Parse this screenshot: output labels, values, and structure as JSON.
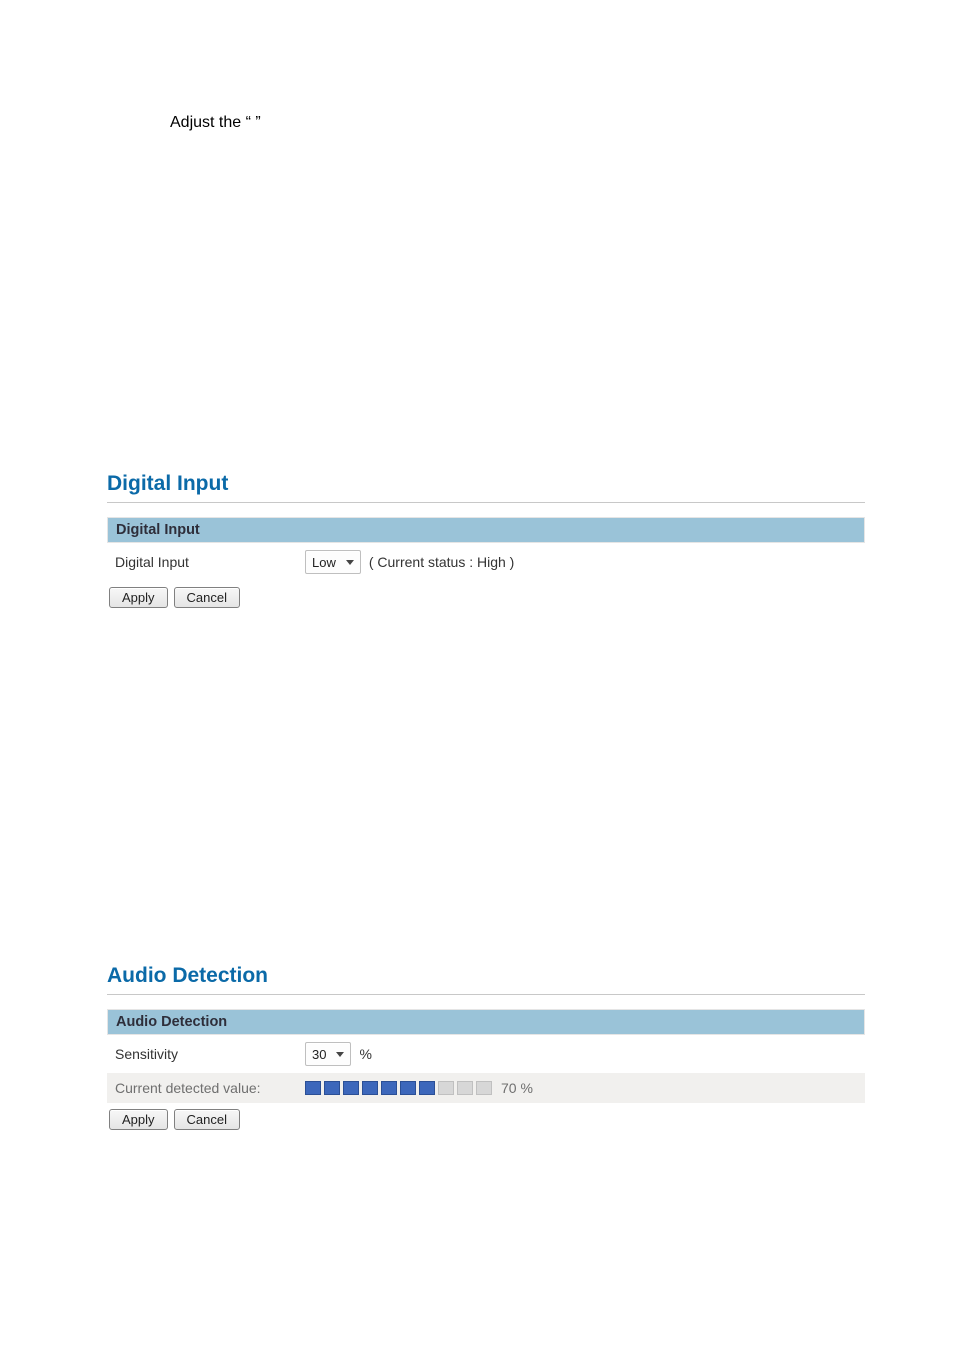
{
  "top_text": "Adjust the “               ”",
  "digital_input": {
    "title": "Digital Input",
    "band": "Digital Input",
    "field_label": "Digital Input",
    "select_value": "Low",
    "status_text": "( Current status : High )",
    "apply": "Apply",
    "cancel": "Cancel"
  },
  "audio_detection": {
    "title": "Audio Detection",
    "band": "Audio Detection",
    "sensitivity_label": "Sensitivity",
    "sensitivity_value": "30",
    "sensitivity_unit": "%",
    "detected_label": "Current detected value:",
    "detected_filled": 7,
    "detected_total": 10,
    "detected_text": "70 %",
    "apply": "Apply",
    "cancel": "Cancel"
  }
}
